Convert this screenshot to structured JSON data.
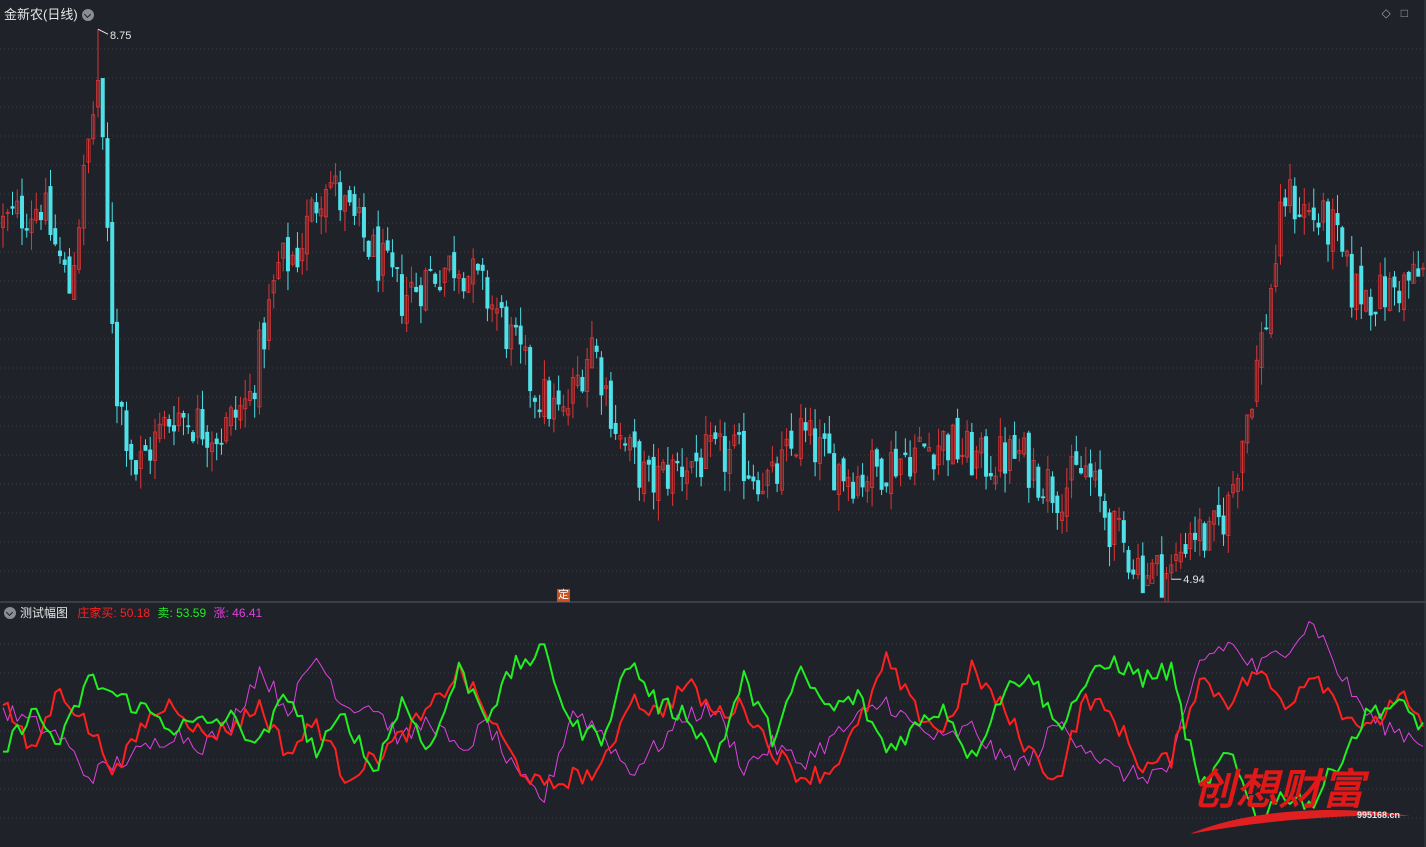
{
  "main_panel": {
    "title": "金新农(日线)",
    "max_label": "8.75",
    "min_label": "4.94",
    "marker_label": "定",
    "colors": {
      "up": "#e03535",
      "down": "#4fe0e8",
      "bg": "#1f2229",
      "grid": "#3a3d45"
    }
  },
  "indicator_panel": {
    "title": "测试幅图",
    "series_labels": [
      {
        "name": "庄家买",
        "value": "50.18",
        "color": "#ff2020"
      },
      {
        "name": "卖",
        "value": "53.59",
        "color": "#22ee22"
      },
      {
        "name": "涨",
        "value": "46.41",
        "color": "#e040e0"
      }
    ]
  },
  "watermark": {
    "text": "创想财富",
    "url": "995168.cn"
  },
  "chart_data": [
    {
      "type": "candlestick",
      "title": "金新农(日线)",
      "x": "trading days (approx. 300 bars)",
      "ylim": [
        4.9,
        8.8
      ],
      "close_anchors": [
        [
          0,
          7.4
        ],
        [
          8,
          7.55
        ],
        [
          14,
          6.95
        ],
        [
          18,
          7.95
        ],
        [
          20,
          8.4
        ],
        [
          24,
          6.25
        ],
        [
          28,
          5.7
        ],
        [
          36,
          6.1
        ],
        [
          46,
          5.95
        ],
        [
          52,
          6.2
        ],
        [
          58,
          7.1
        ],
        [
          62,
          7.2
        ],
        [
          68,
          7.75
        ],
        [
          72,
          7.5
        ],
        [
          78,
          7.2
        ],
        [
          84,
          6.9
        ],
        [
          90,
          7.05
        ],
        [
          96,
          7.15
        ],
        [
          104,
          6.8
        ],
        [
          112,
          6.25
        ],
        [
          118,
          6.05
        ],
        [
          124,
          6.6
        ],
        [
          130,
          5.9
        ],
        [
          136,
          5.6
        ],
        [
          144,
          5.75
        ],
        [
          154,
          5.8
        ],
        [
          162,
          5.6
        ],
        [
          168,
          5.95
        ],
        [
          174,
          5.75
        ],
        [
          180,
          5.65
        ],
        [
          190,
          5.8
        ],
        [
          198,
          5.9
        ],
        [
          206,
          5.75
        ],
        [
          214,
          5.8
        ],
        [
          222,
          5.55
        ],
        [
          228,
          5.7
        ],
        [
          234,
          5.25
        ],
        [
          240,
          5.0
        ],
        [
          246,
          4.98
        ],
        [
          250,
          5.3
        ],
        [
          254,
          5.2
        ],
        [
          258,
          5.45
        ],
        [
          262,
          6.1
        ],
        [
          266,
          6.75
        ],
        [
          270,
          7.6
        ],
        [
          276,
          7.45
        ],
        [
          280,
          7.35
        ],
        [
          284,
          6.95
        ],
        [
          290,
          6.9
        ],
        [
          299,
          7.05
        ]
      ],
      "max_point": {
        "bar": 20,
        "value": 8.75
      },
      "min_point": {
        "bar": 246,
        "value": 4.94
      }
    },
    {
      "type": "line",
      "title": "测试幅图",
      "ylim": [
        0,
        100
      ],
      "x": "same trading days as main panel",
      "series": [
        {
          "name": "庄家买",
          "last": 50.18,
          "anchors": [
            [
              0,
              65
            ],
            [
              6,
              40
            ],
            [
              12,
              70
            ],
            [
              18,
              52
            ],
            [
              24,
              32
            ],
            [
              30,
              55
            ],
            [
              36,
              64
            ],
            [
              42,
              48
            ],
            [
              48,
              52
            ],
            [
              54,
              62
            ],
            [
              60,
              40
            ],
            [
              66,
              55
            ],
            [
              72,
              30
            ],
            [
              78,
              38
            ],
            [
              84,
              48
            ],
            [
              90,
              60
            ],
            [
              96,
              78
            ],
            [
              102,
              58
            ],
            [
              108,
              36
            ],
            [
              114,
              24
            ],
            [
              120,
              30
            ],
            [
              126,
              32
            ],
            [
              132,
              66
            ],
            [
              138,
              58
            ],
            [
              144,
              72
            ],
            [
              150,
              58
            ],
            [
              156,
              62
            ],
            [
              162,
              42
            ],
            [
              168,
              30
            ],
            [
              174,
              32
            ],
            [
              180,
              52
            ],
            [
              186,
              82
            ],
            [
              192,
              60
            ],
            [
              198,
              50
            ],
            [
              204,
              78
            ],
            [
              210,
              62
            ],
            [
              216,
              42
            ],
            [
              222,
              28
            ],
            [
              228,
              66
            ],
            [
              234,
              56
            ],
            [
              240,
              34
            ],
            [
              246,
              38
            ],
            [
              252,
              74
            ],
            [
              258,
              64
            ],
            [
              264,
              78
            ],
            [
              270,
              62
            ],
            [
              276,
              78
            ],
            [
              282,
              60
            ],
            [
              288,
              50
            ],
            [
              294,
              68
            ],
            [
              299,
              50
            ]
          ]
        },
        {
          "name": "卖",
          "last": 53.59,
          "anchors": [
            [
              0,
              40
            ],
            [
              6,
              60
            ],
            [
              12,
              44
            ],
            [
              18,
              74
            ],
            [
              24,
              66
            ],
            [
              30,
              60
            ],
            [
              36,
              52
            ],
            [
              42,
              54
            ],
            [
              48,
              56
            ],
            [
              54,
              44
            ],
            [
              60,
              68
            ],
            [
              66,
              40
            ],
            [
              72,
              58
            ],
            [
              78,
              32
            ],
            [
              84,
              64
            ],
            [
              90,
              42
            ],
            [
              96,
              78
            ],
            [
              102,
              58
            ],
            [
              108,
              80
            ],
            [
              114,
              86
            ],
            [
              120,
              52
            ],
            [
              126,
              48
            ],
            [
              132,
              82
            ],
            [
              138,
              62
            ],
            [
              144,
              58
            ],
            [
              150,
              38
            ],
            [
              156,
              74
            ],
            [
              162,
              48
            ],
            [
              168,
              76
            ],
            [
              174,
              60
            ],
            [
              180,
              66
            ],
            [
              186,
              42
            ],
            [
              192,
              52
            ],
            [
              198,
              62
            ],
            [
              204,
              38
            ],
            [
              210,
              66
            ],
            [
              216,
              78
            ],
            [
              222,
              52
            ],
            [
              228,
              72
            ],
            [
              234,
              82
            ],
            [
              240,
              74
            ],
            [
              246,
              78
            ],
            [
              252,
              24
            ],
            [
              258,
              40
            ],
            [
              264,
              12
            ],
            [
              270,
              22
            ],
            [
              276,
              18
            ],
            [
              282,
              40
            ],
            [
              288,
              60
            ],
            [
              294,
              62
            ],
            [
              299,
              53
            ]
          ]
        },
        {
          "name": "涨",
          "last": 46.41,
          "anchors": [
            [
              0,
              60
            ],
            [
              6,
              54
            ],
            [
              12,
              48
            ],
            [
              18,
              30
            ],
            [
              24,
              36
            ],
            [
              30,
              42
            ],
            [
              36,
              50
            ],
            [
              42,
              44
            ],
            [
              48,
              54
            ],
            [
              54,
              78
            ],
            [
              60,
              60
            ],
            [
              66,
              84
            ],
            [
              72,
              62
            ],
            [
              78,
              62
            ],
            [
              84,
              46
            ],
            [
              90,
              56
            ],
            [
              96,
              40
            ],
            [
              102,
              54
            ],
            [
              108,
              30
            ],
            [
              114,
              20
            ],
            [
              120,
              60
            ],
            [
              126,
              50
            ],
            [
              132,
              32
            ],
            [
              138,
              44
            ],
            [
              144,
              58
            ],
            [
              150,
              60
            ],
            [
              156,
              34
            ],
            [
              162,
              44
            ],
            [
              168,
              36
            ],
            [
              174,
              46
            ],
            [
              180,
              56
            ],
            [
              186,
              64
            ],
            [
              192,
              52
            ],
            [
              198,
              46
            ],
            [
              204,
              52
            ],
            [
              210,
              38
            ],
            [
              216,
              36
            ],
            [
              222,
              54
            ],
            [
              228,
              44
            ],
            [
              234,
              32
            ],
            [
              240,
              30
            ],
            [
              246,
              34
            ],
            [
              252,
              82
            ],
            [
              258,
              90
            ],
            [
              264,
              78
            ],
            [
              270,
              88
            ],
            [
              276,
              100
            ],
            [
              282,
              74
            ],
            [
              288,
              56
            ],
            [
              294,
              50
            ],
            [
              299,
              46
            ]
          ]
        }
      ]
    }
  ]
}
